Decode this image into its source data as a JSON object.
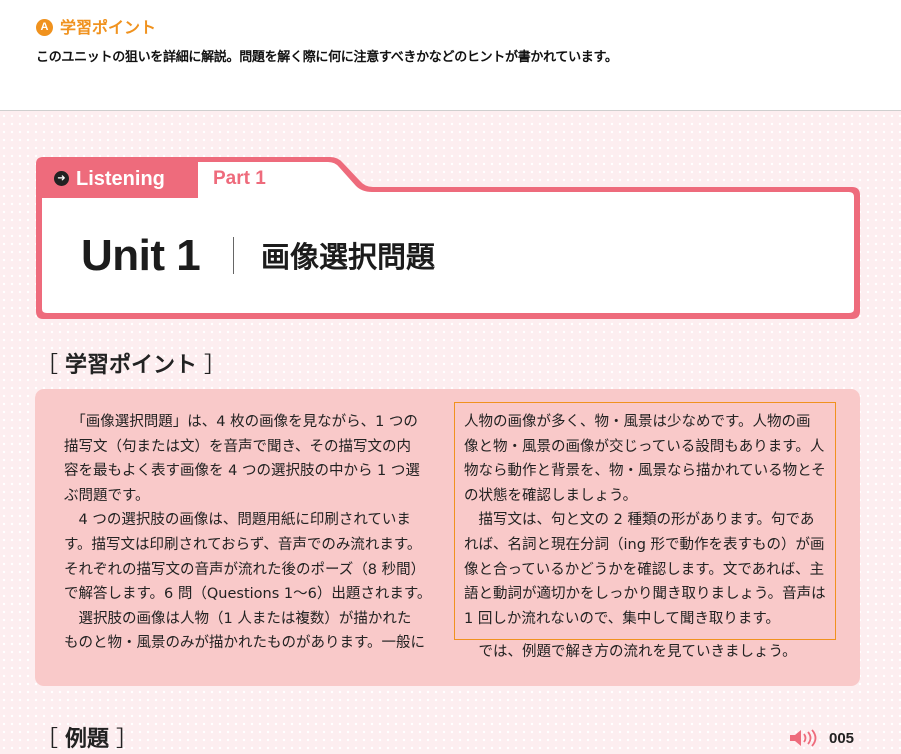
{
  "header": {
    "badge": "A",
    "title": "学習ポイント",
    "description": "このユニットの狙いを詳細に解説。問題を解く際に何に注意すべきかなどのヒントが書かれています。"
  },
  "tabs": {
    "listening": "Listening",
    "part": "Part 1"
  },
  "unit": {
    "number": "Unit 1",
    "title": "画像選択問題"
  },
  "learning_point": {
    "heading": "学習ポイント",
    "left_text": "　「画像選択問題」は、4 枚の画像を見ながら、1 つの\n描写文（句または文）を音声で聞き、その描写文の内\n容を最もよく表す画像を 4 つの選択肢の中から 1 つ選\nぶ問題です。\n　4 つの選択肢の画像は、問題用紙に印刷されていま\nす。描写文は印刷されておらず、音声でのみ流れます。\nそれぞれの描写文の音声が流れた後のポーズ（8 秒間）\nで解答します。6 問（Questions 1〜6）出題されます。\n　選択肢の画像は人物（1 人または複数）が描かれた\nものと物・風景のみが描かれたものがあります。一般に",
    "right_text": "人物の画像が多く、物・風景は少なめです。人物の画\n像と物・風景の画像が交じっている設問もあります。人\n物なら動作と背景を、物・風景なら描かれている物とそ\nの状態を確認しましょう。\n　描写文は、句と文の 2 種類の形があります。句であ\nれば、名詞と現在分詞（ing 形で動作を表すもの）が画\n像と合っているかどうかを確認します。文であれば、主\n語と動詞が適切かをしっかり聞き取りましょう。音声は\n1 回しか流れないので、集中して聞き取ります。",
    "closing": "　では、例題で解き方の流れを見ていきましょう。"
  },
  "example": {
    "heading": "例題"
  },
  "footer": {
    "page_number": "005"
  },
  "colors": {
    "accent_pink": "#ee6b7c",
    "accent_orange": "#f0921e",
    "box_pink": "#f9c9c9"
  },
  "icons": [
    "arrow-right-icon",
    "speaker-icon"
  ]
}
